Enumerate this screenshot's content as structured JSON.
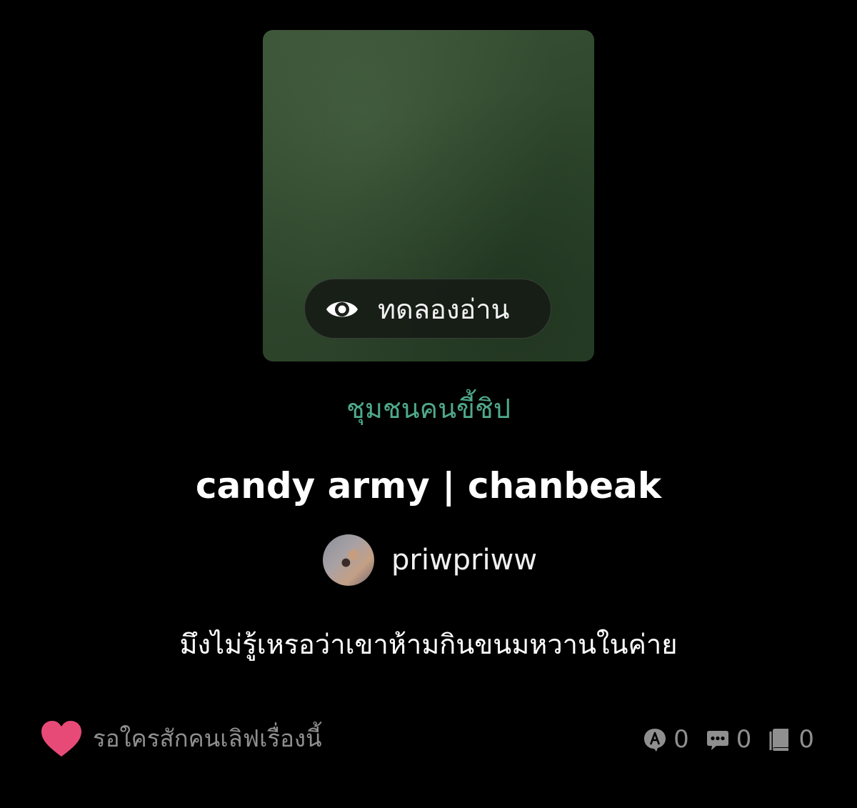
{
  "cover": {
    "preview_button_label": "ทดลองอ่าน",
    "preview_icon": "eye-icon"
  },
  "story": {
    "category": "ชุมชนคนขี้ชิป",
    "title": "candy army | chanbeak",
    "author_name": "priwpriww",
    "synopsis": "มึงไม่รู้เหรอว่าเขาห้ามกินขนมหวานในค่าย"
  },
  "love": {
    "text": "รอใครสักคนเลิฟเรื่องนี้",
    "icon": "heart-icon",
    "color": "#e84a78"
  },
  "stats": {
    "reads": "0",
    "comments": "0",
    "chapters": "0"
  },
  "colors": {
    "background": "#000000",
    "category": "#4fa98c",
    "muted": "#8f8f8f"
  }
}
